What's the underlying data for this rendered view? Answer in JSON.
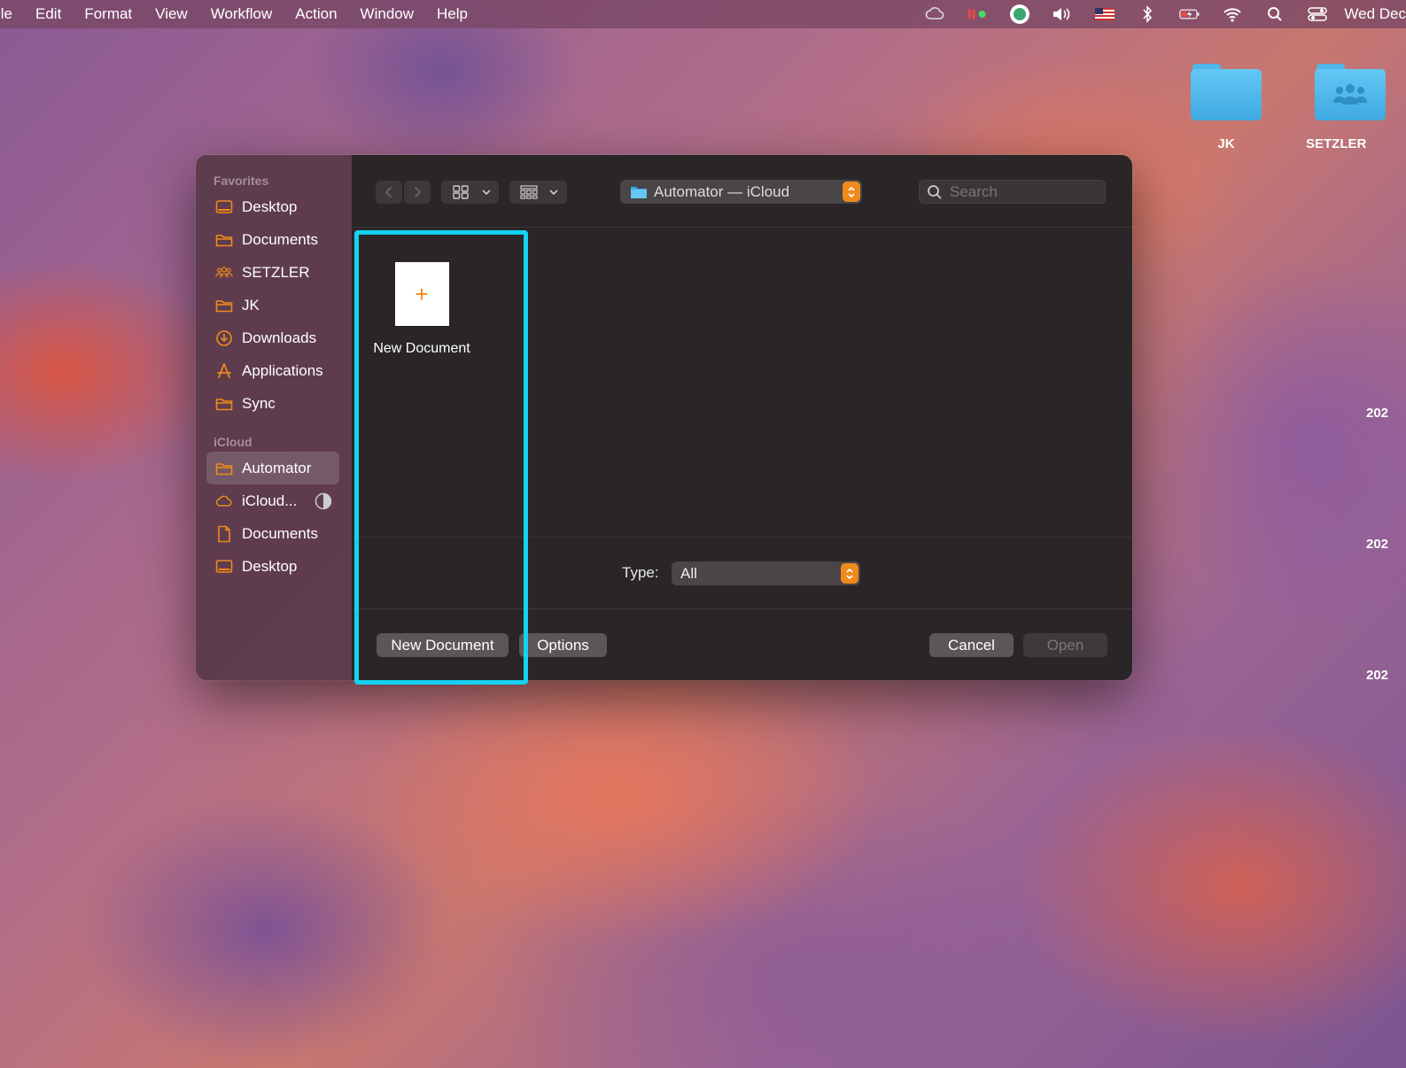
{
  "menubar": {
    "items": [
      "ile",
      "Edit",
      "Format",
      "View",
      "Workflow",
      "Action",
      "Window",
      "Help"
    ],
    "clock": "Wed Dec"
  },
  "desktop": {
    "icons": [
      {
        "label": "JK"
      },
      {
        "label": "SETZLER"
      }
    ],
    "edge_labels": [
      "202",
      "202",
      "202"
    ]
  },
  "sidebar": {
    "favorites_header": "Favorites",
    "favorites": [
      {
        "label": "Desktop",
        "icon": "desktop-icon"
      },
      {
        "label": "Documents",
        "icon": "folder-icon"
      },
      {
        "label": "SETZLER",
        "icon": "shared-users-icon"
      },
      {
        "label": "JK",
        "icon": "folder-icon"
      },
      {
        "label": "Downloads",
        "icon": "download-icon"
      },
      {
        "label": "Applications",
        "icon": "applications-icon"
      },
      {
        "label": "Sync",
        "icon": "folder-icon"
      }
    ],
    "icloud_header": "iCloud",
    "icloud": [
      {
        "label": "Automator",
        "icon": "folder-icon",
        "selected": true
      },
      {
        "label": "iCloud...",
        "icon": "cloud-icon"
      },
      {
        "label": "Documents",
        "icon": "document-icon"
      },
      {
        "label": "Desktop",
        "icon": "desktop-icon"
      }
    ]
  },
  "toolbar": {
    "location": "Automator — iCloud",
    "search_placeholder": "Search"
  },
  "files": [
    {
      "label": "New Document",
      "thumb_glyph": "+"
    }
  ],
  "type_row": {
    "label": "Type:",
    "value": "All"
  },
  "buttons": {
    "new_document": "New Document",
    "options": "Options",
    "cancel": "Cancel",
    "open": "Open"
  },
  "colors": {
    "accent": "#ef8a1c",
    "highlight": "#14d1f0",
    "sidebar_icon": "#ef8a1c"
  }
}
